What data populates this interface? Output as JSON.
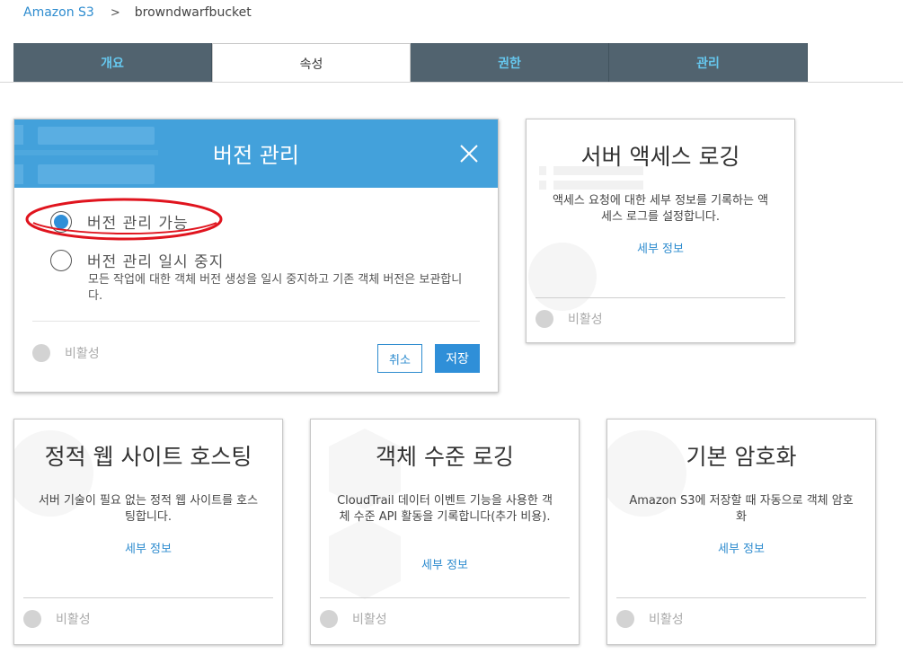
{
  "breadcrumb": {
    "root": "Amazon S3",
    "separator": ">",
    "bucket": "browndwarfbucket"
  },
  "tabs": [
    "개요",
    "속성",
    "권한",
    "관리"
  ],
  "active_tab": "속성",
  "versioning_modal": {
    "title": "버전 관리",
    "option_enable": "버전 관리 가능",
    "option_suspend": "버전 관리 일시 중지",
    "suspend_desc": "모든 작업에 대한 객체 버전 생성을 일시 중지하고 기존 객체 버전은 보관합니다.",
    "selected": "enable",
    "status": "비활성",
    "cancel_label": "취소",
    "save_label": "저장"
  },
  "cards": {
    "access_logging": {
      "title": "서버 액세스 로깅",
      "desc": "액세스 요청에 대한 세부 정보를 기록하는 액세스 로그를 설정합니다.",
      "link": "세부 정보",
      "status": "비활성"
    },
    "static_hosting": {
      "title": "정적 웹 사이트 호스팅",
      "desc": "서버 기술이 필요 없는 정적 웹 사이트를 호스팅합니다.",
      "link": "세부 정보",
      "status": "비활성"
    },
    "object_logging": {
      "title": "객체 수준 로깅",
      "desc": "CloudTrail 데이터 이벤트 기능을 사용한 객체 수준 API 활동을 기록합니다(추가 비용).",
      "link": "세부 정보",
      "status": "비활성"
    },
    "default_encryption": {
      "title": "기본 암호화",
      "desc": "Amazon S3에 저장할 때 자동으로 객체 암호화",
      "link": "세부 정보",
      "status": "비활성"
    }
  },
  "colors": {
    "tab_bg": "#51636f",
    "tab_text": "#66c8ef",
    "modal_header": "#43a1db",
    "link": "#2e8ccf",
    "primary_button": "#2f8fd8",
    "annotation": "#e0141e"
  }
}
